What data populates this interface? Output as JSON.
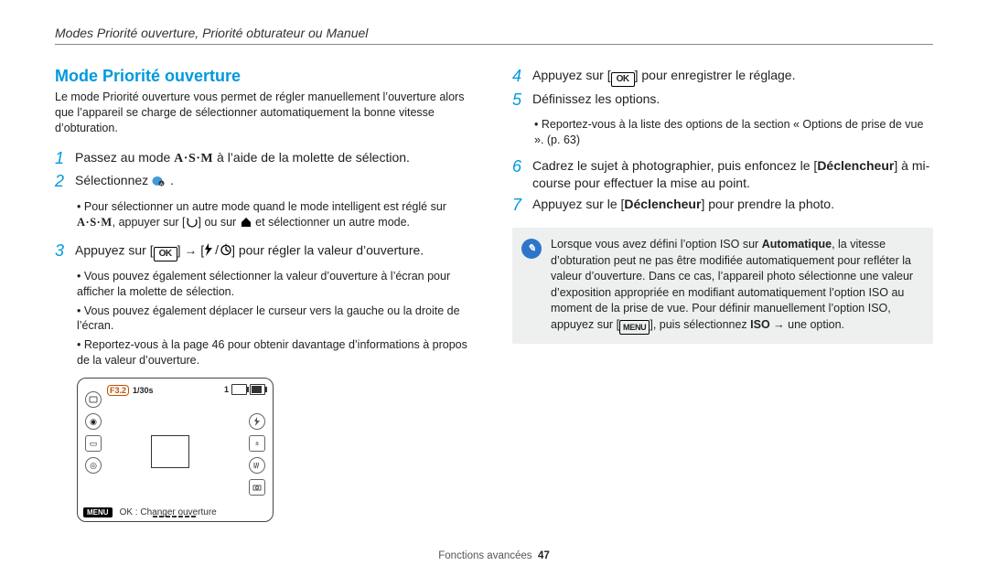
{
  "header": {
    "title": "Modes Priorité ouverture, Priorité obturateur ou Manuel"
  },
  "heading": "Mode Priorité ouverture",
  "intro": "Le mode Priorité ouverture vous permet de régler manuellement l’ouverture alors que l’appareil se charge de sélectionner automatiquement la bonne vitesse d’obturation.",
  "glyphs": {
    "asm": "A·S·M",
    "ok": "OK",
    "menu": "MENU",
    "arrow": "→"
  },
  "left_steps": {
    "s1_a": "Passez au mode ",
    "s1_b": " à l’aide de la molette de sélection.",
    "s2": "Sélectionnez ",
    "s2_sub1_a": "Pour sélectionner un autre mode quand le mode intelligent est réglé sur ",
    "s2_sub1_b": ", appuyer sur [",
    "s2_sub1_c": "] ou sur ",
    "s2_sub1_d": " et sélectionner un autre mode.",
    "s3_a": "Appuyez sur [",
    "s3_b": "] → [",
    "s3_c": "] pour régler la valeur d’ouverture.",
    "s3_sub1": "Vous pouvez également sélectionner la valeur d’ouverture à l’écran pour afficher la molette de sélection.",
    "s3_sub2": "Vous pouvez également déplacer le curseur vers la gauche ou la droite de l’écran.",
    "s3_sub3": "Reportez-vous à la page 46 pour obtenir davantage d’informations à propos de la valeur d’ouverture."
  },
  "right_steps": {
    "s4_a": "Appuyez sur [",
    "s4_b": "] pour enregistrer le réglage.",
    "s5": "Définissez les options.",
    "s5_sub1": "Reportez-vous à la liste des options de la section « Options de prise de vue ». (p. 63)",
    "s6_a": "Cadrez le sujet à photographier, puis enfoncez le [",
    "s6_bold": "Déclencheur",
    "s6_b": "] à mi-course pour effectuer la mise au point.",
    "s7_a": "Appuyez sur le [",
    "s7_bold": "Déclencheur",
    "s7_b": "] pour prendre la photo."
  },
  "note": {
    "a": "Lorsque vous avez défini l’option ISO sur ",
    "auto": "Automatique",
    "b": ", la vitesse d’obturation peut ne pas être modifiée automatiquement pour refléter la valeur d’ouverture. Dans ce cas, l’appareil photo sélectionne une valeur d’exposition appropriée en modifiant automatiquement l’option ISO au moment de la prise de vue. Pour définir manuellement l’option ISO, appuyez sur [",
    "c": "], puis sélectionnez ",
    "iso": "ISO",
    "d": " → une option."
  },
  "viewer": {
    "fstop": "F3.2",
    "shutter": "1/30s",
    "menu": "MENU",
    "ok_caption": "OK : Changer ouverture",
    "count": "1"
  },
  "footer": {
    "section": "Fonctions avancées",
    "page": "47"
  }
}
